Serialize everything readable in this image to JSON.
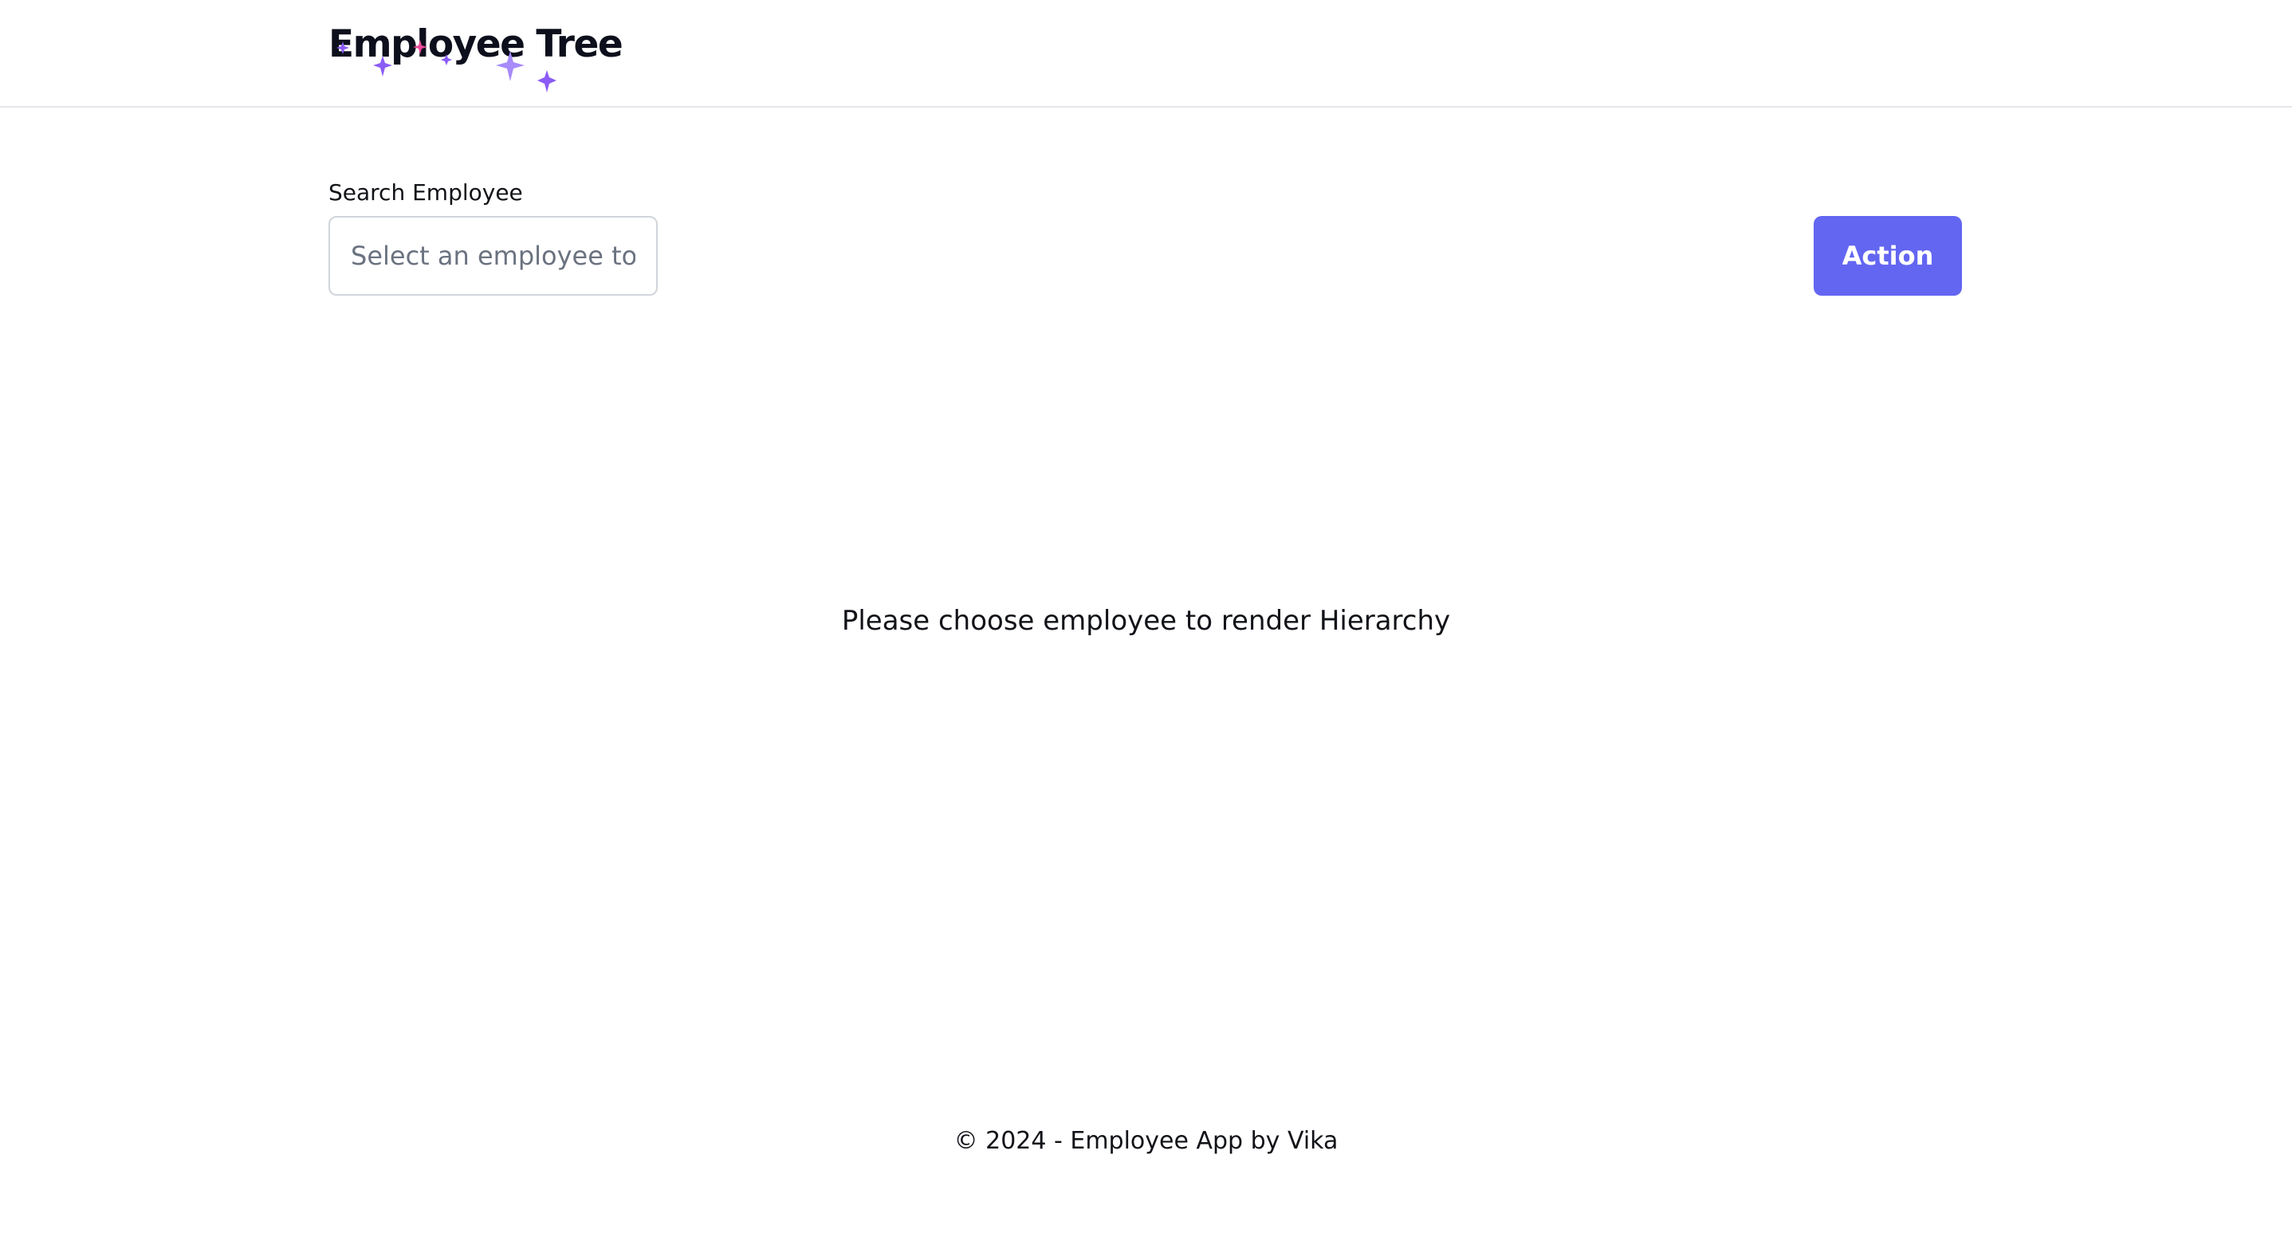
{
  "header": {
    "title": "Employee Tree",
    "sparkle_colors": {
      "purple": "#8b5cf6",
      "pink": "#ec4899"
    }
  },
  "search": {
    "label": "Search Employee",
    "placeholder": "Select an employee to search",
    "value": ""
  },
  "toolbar": {
    "action_label": "Action",
    "action_color": "#6366f1"
  },
  "main": {
    "empty_message": "Please choose employee to render Hierarchy"
  },
  "footer": {
    "text": "© 2024 - Employee App by Vika"
  }
}
